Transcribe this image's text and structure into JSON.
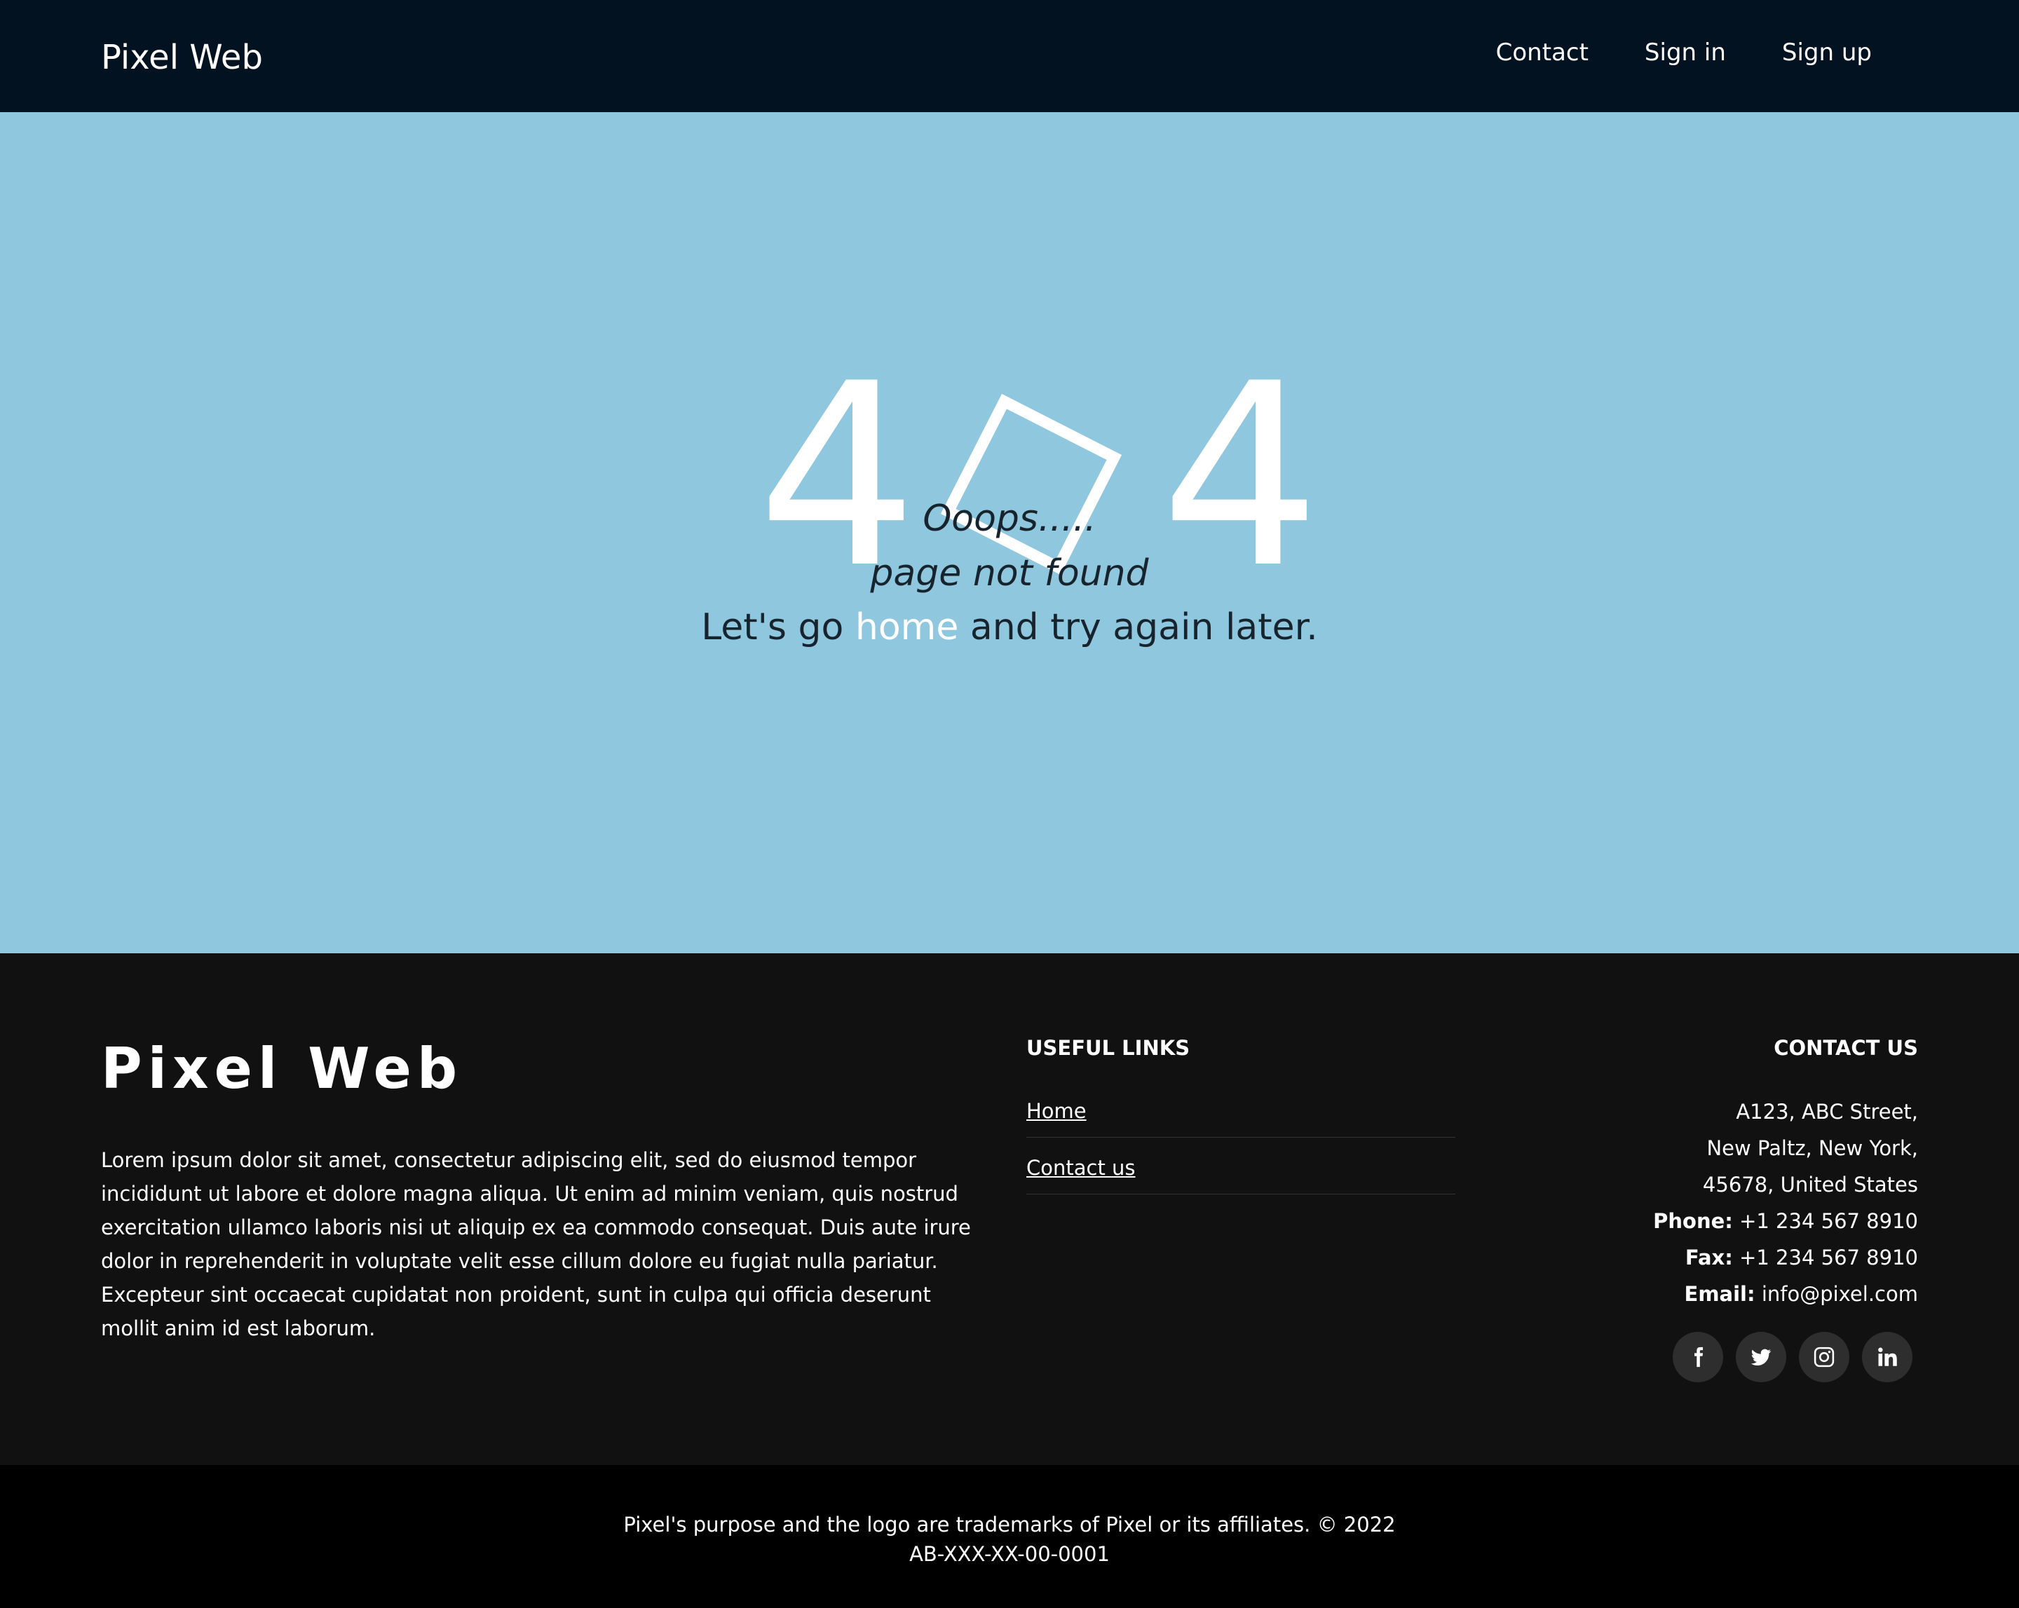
{
  "nav": {
    "brand": "Pixel Web",
    "links": [
      "Contact",
      "Sign in",
      "Sign up"
    ]
  },
  "hero": {
    "four": "4",
    "ooops": "Ooops.....",
    "not_found": "page not found",
    "cta_prefix": "Let's go",
    "cta_link": "home",
    "cta_suffix": "and try again later."
  },
  "footer": {
    "brand": "Pixel Web",
    "about": "Lorem ipsum dolor sit amet, consectetur adipiscing elit, sed do eiusmod tempor incididunt ut labore et dolore magna aliqua. Ut enim ad minim veniam, quis nostrud exercitation ullamco laboris nisi ut aliquip ex ea commodo consequat. Duis aute irure dolor in reprehenderit in voluptate velit esse cillum dolore eu fugiat nulla pariatur. Excepteur sint occaecat cupidatat non proident, sunt in culpa qui officia deserunt mollit anim id est laborum.",
    "useful_links": {
      "title": "USEFUL LINKS",
      "items": [
        "Home",
        "Contact us"
      ]
    },
    "contact": {
      "title": "CONTACT US",
      "address": [
        "A123, ABC Street,",
        "New Paltz, New York,",
        "45678, United States"
      ],
      "phone_label": "Phone:",
      "phone": "+1 234 567 8910",
      "fax_label": "Fax:",
      "fax": "+1 234 567 8910",
      "email_label": "Email:",
      "email": "info@pixel.com"
    },
    "socials": [
      "facebook-icon",
      "twitter-icon",
      "instagram-icon",
      "linkedin-icon"
    ]
  },
  "bottom": {
    "line1": "Pixel's purpose and the logo are trademarks of Pixel or its affiliates. © 2022",
    "line2": "AB-XXX-XX-00-0001"
  },
  "colors": {
    "navbar_bg": "#031220",
    "hero_bg": "#8fc7de",
    "footer_bg": "#111111",
    "bottom_bg": "#000000"
  }
}
